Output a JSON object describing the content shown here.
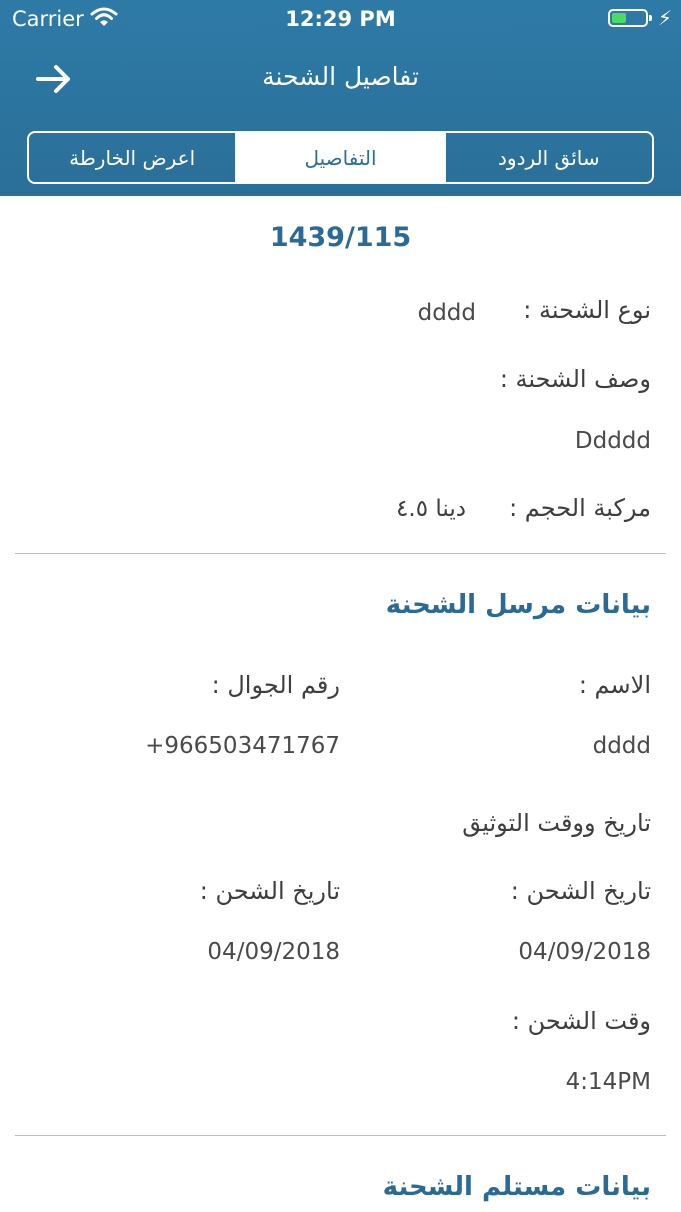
{
  "status_bar": {
    "carrier": "Carrier",
    "time": "12:29 PM"
  },
  "navbar": {
    "title": "تفاصيل الشحنة",
    "back_arrow": "→"
  },
  "segments": [
    {
      "label": "اعرض الخارطة",
      "selected": false
    },
    {
      "label": "التفاصيل",
      "selected": true
    },
    {
      "label": "سائق الردود",
      "selected": false
    }
  ],
  "shipment": {
    "number": "1439/115",
    "type_label": "نوع الشحنة :",
    "type_value": "dddd",
    "desc_label": "وصف الشحنة :",
    "desc_value": "Ddddd",
    "vehicle_label": "مركبة الحجم :",
    "vehicle_value": "دينا ٤.٥"
  },
  "sender": {
    "section_title": "بيانات مرسل الشحنة",
    "name_label": "الاسم :",
    "name_value": "dddd",
    "phone_label": "رقم الجوال :",
    "phone_value": "+966503471767"
  },
  "documentation": {
    "heading": "تاريخ ووقت التوثيق",
    "ship_date_label": "تاريخ الشحن :",
    "ship_date_value": "04/09/2018",
    "ship_date_label_2": "تاريخ الشحن :",
    "ship_date_value_2": "04/09/2018",
    "ship_time_label": "وقت الشحن :",
    "ship_time_value": "4:14PM"
  },
  "receiver": {
    "section_title": "بيانات مستلم الشحنة"
  },
  "colors": {
    "header": "#2e7aa7",
    "accent": "#2a6a96",
    "battery": "#4cd964"
  },
  "icons": {
    "wifi": "wifi-icon",
    "battery": "battery-icon",
    "charging": "charging-bolt-icon",
    "back": "back-arrow-icon"
  }
}
